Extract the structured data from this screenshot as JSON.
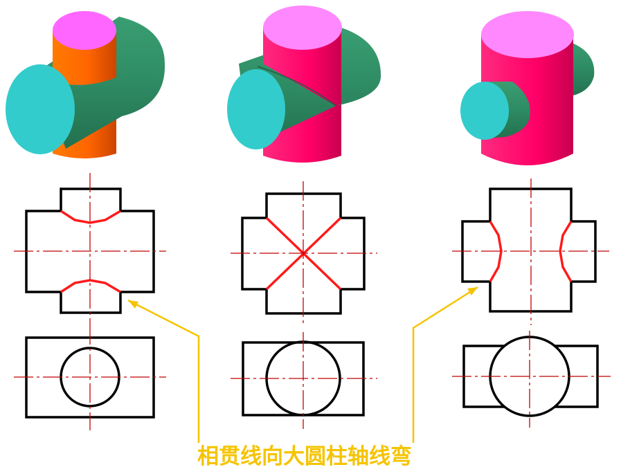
{
  "caption": "相贯线向大圆柱轴线弯",
  "colors": {
    "caption": "#f5c400",
    "arrow": "#f5c400",
    "outline": "#000000",
    "intersection": "#ff1a1a",
    "centerline": "#c00000",
    "top_face": "#ff66ff",
    "top_face_light": "#ff88ff",
    "end_face": "#33cccc",
    "horizontal_body": "#2e8b63",
    "vertical_body_small": "#ff6600",
    "vertical_body_large": "#ff0066"
  },
  "figures": [
    {
      "case": "vertical-cylinder-smaller",
      "render_3d": "3d-model-small-vertical"
    },
    {
      "case": "equal-diameters",
      "render_3d": "3d-model-equal-diameter"
    },
    {
      "case": "horizontal-cylinder-smaller",
      "render_3d": "3d-model-small-horizontal"
    }
  ]
}
